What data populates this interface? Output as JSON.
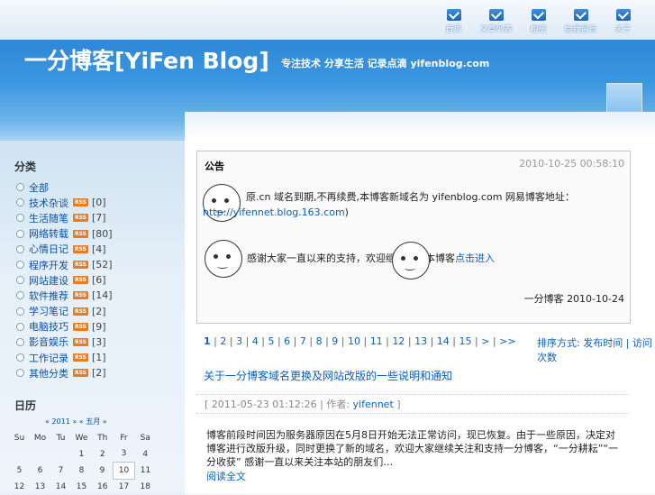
{
  "nav": [
    {
      "label": "首页",
      "icon": "arrow-icon"
    },
    {
      "label": "文章列表",
      "icon": "arrow-icon"
    },
    {
      "label": "相册",
      "icon": "arrow-icon"
    },
    {
      "label": "给我留言",
      "icon": "arrow-icon"
    },
    {
      "label": "关于",
      "icon": "arrow-icon"
    }
  ],
  "header": {
    "title": "一分博客[YiFen Blog]",
    "subtitle": "专注技术 分享生活 记录点滴 yifenblog.com"
  },
  "sidebar": {
    "categories_heading": "分类",
    "categories": [
      {
        "name": "全部",
        "rss": "",
        "count": ""
      },
      {
        "name": "技术杂谈",
        "rss": "RSS",
        "count": "[0]"
      },
      {
        "name": "生活随笔",
        "rss": "RSS",
        "count": "[7]"
      },
      {
        "name": "网络转载",
        "rss": "RSS",
        "count": "[80]"
      },
      {
        "name": "心情日记",
        "rss": "RSS",
        "count": "[4]"
      },
      {
        "name": "程序开发",
        "rss": "RSS",
        "count": "[52]"
      },
      {
        "name": "网站建设",
        "rss": "RSS",
        "count": "[6]"
      },
      {
        "name": "软件推荐",
        "rss": "RSS",
        "count": "[14]"
      },
      {
        "name": "学习笔记",
        "rss": "RSS",
        "count": "[2]"
      },
      {
        "name": "电脑技巧",
        "rss": "RSS",
        "count": "[9]"
      },
      {
        "name": "影音娱乐",
        "rss": "RSS",
        "count": "[3]"
      },
      {
        "name": "工作记录",
        "rss": "RSS",
        "count": "[1]"
      },
      {
        "name": "其他分类",
        "rss": "RSS",
        "count": "[2]"
      }
    ],
    "calendar_heading": "日历",
    "calendar_nav": "« 2011 » « 五月 »",
    "weekdays": [
      "Su",
      "Mo",
      "Tu",
      "We",
      "Th",
      "Fr",
      "Sa"
    ],
    "weeks": [
      [
        "",
        "",
        "",
        "1",
        "2",
        "3",
        "4"
      ],
      [
        "5",
        "6",
        "7",
        "8",
        "9",
        "10",
        "11"
      ],
      [
        "12",
        "13",
        "14",
        "15",
        "16",
        "17",
        "18"
      ]
    ],
    "today": "10"
  },
  "notice": {
    "heading": "公告",
    "time": "2010-10-25 00:58:10",
    "line1_text": "原.cn 域名到期,不再续费,本博客新域名为 yifenblog.com 网易博客地址：",
    "line1_link": "http://yifennet.blog.163.com",
    "line1_end": ")",
    "line2_text": "感谢大家一直以来的支持，欢迎继续访问本博客",
    "line2_link": "点击进入",
    "sign_name": "一分博客",
    "sign_date": "2010-10-24"
  },
  "pager": {
    "pages": [
      "1",
      "2",
      "3",
      "4",
      "5",
      "6",
      "7",
      "8",
      "9",
      "10",
      "11",
      "12",
      "13",
      "14",
      "15",
      ">",
      ">>"
    ],
    "order_label": "排序方式:",
    "order_a": "发布时间",
    "order_b": "访问次数"
  },
  "post": {
    "title": "关于一分博客域名更换及网站改版的一些说明和通知",
    "meta_prefix": "[ 2011-05-23 01:12:26 | 作者:",
    "author": "yifennet",
    "meta_suffix": "]",
    "body": "博客前段时间因为服务器原因在5月8日开始无法正常访问，现已恢复。由于一些原因，决定对博客进行改版升级，同时更换了新的域名，欢迎大家继续关注和支持一分博客，“一分耕耘”“一分收获” 感谢一直以来关注本站的朋友们…",
    "read_more": "阅读全文"
  }
}
